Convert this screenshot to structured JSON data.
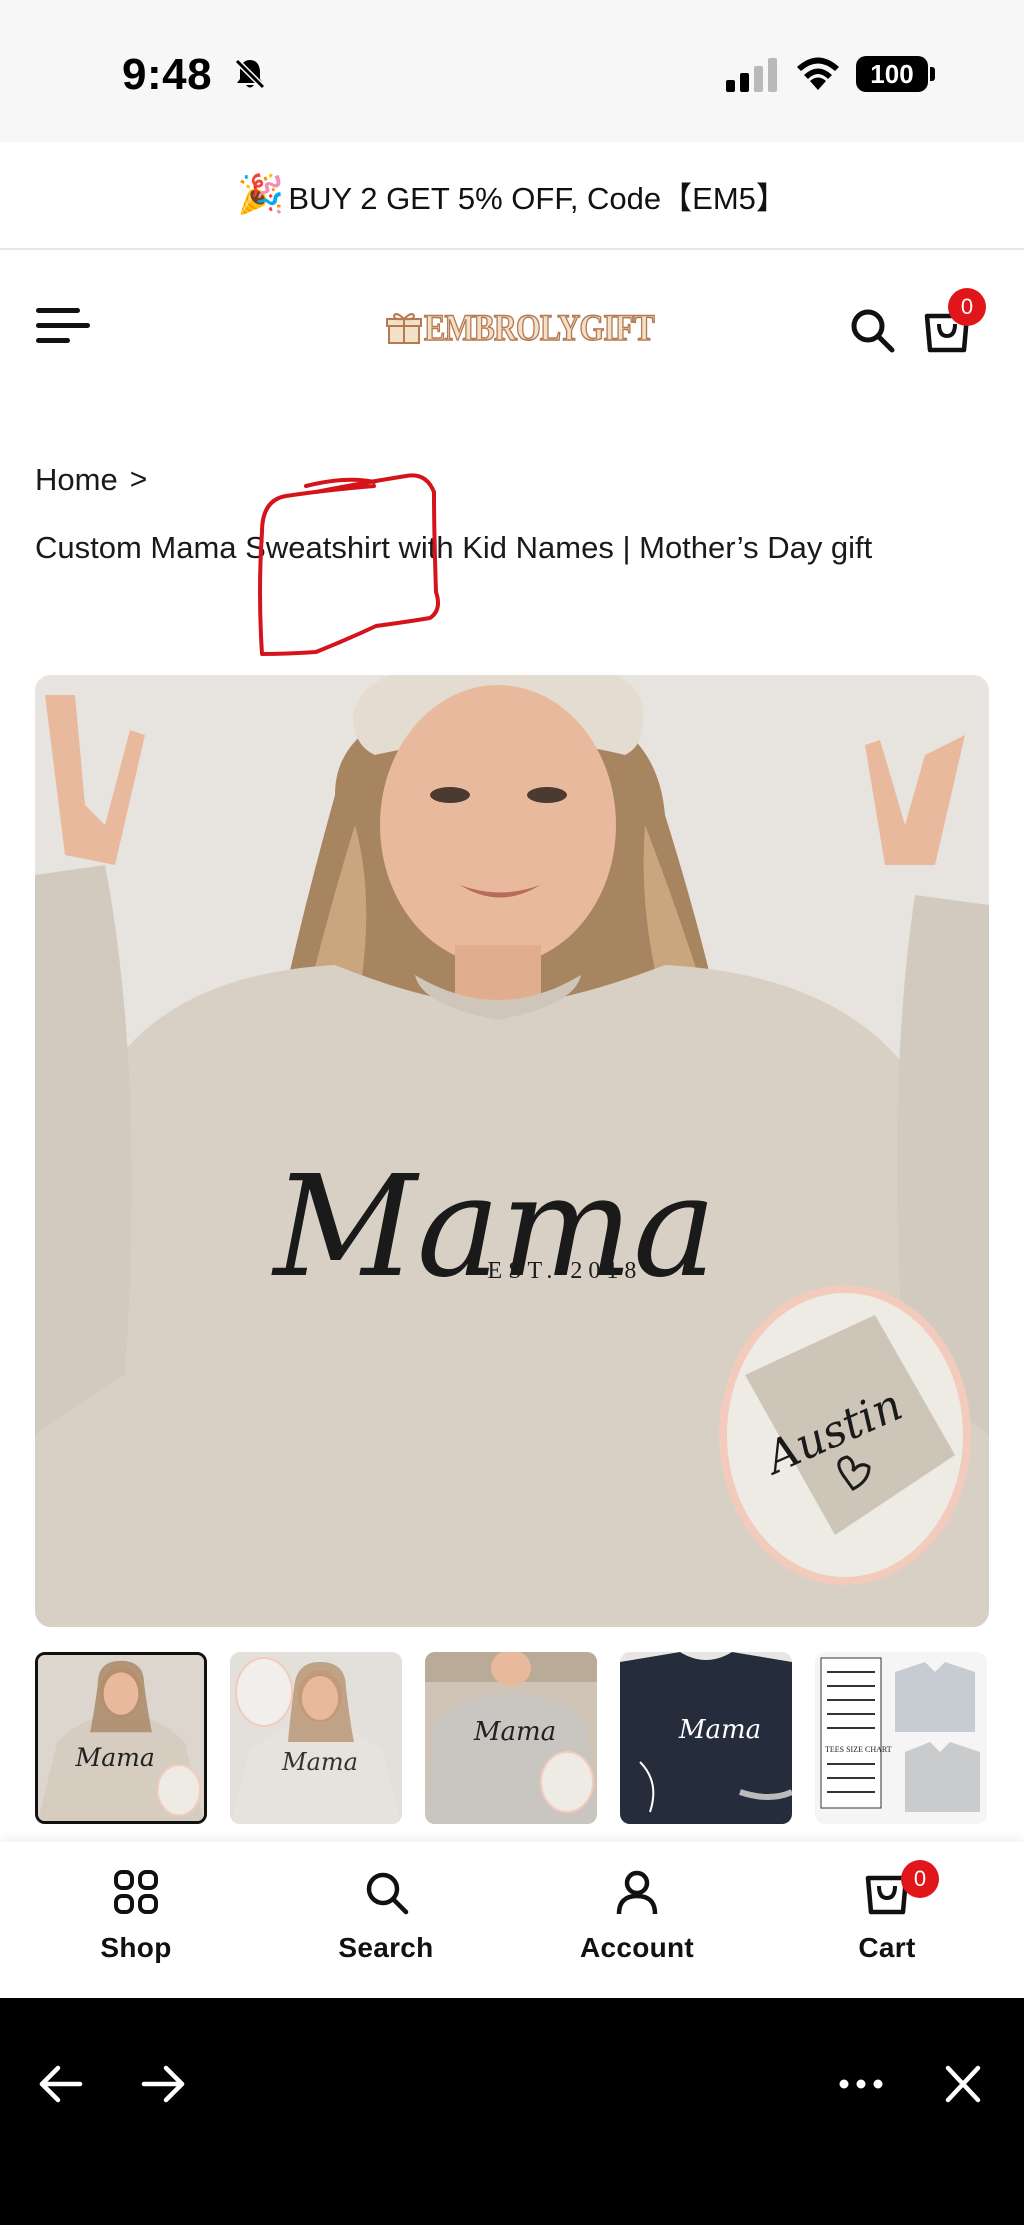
{
  "status_bar": {
    "time": "9:48",
    "battery": "100"
  },
  "promo": {
    "icon": "party-popper-icon",
    "text": "BUY 2 GET 5% OFF, Code【EM5】"
  },
  "header": {
    "logo_text": "EMBROLYGIFT",
    "cart_count": "0"
  },
  "breadcrumb": {
    "home_label": "Home",
    "separator": ">"
  },
  "product": {
    "title": "Custom Mama Sweatshirt with Kid Names | Mother’s Day gift",
    "image_print_main": "Mama",
    "image_print_est": "EST. 2018",
    "image_sleeve_name": "Austin"
  },
  "thumbnails": {
    "count": 5,
    "active_index": 0,
    "size_chart_label": "TEES SIZE CHART"
  },
  "bottom_nav": {
    "shop_label": "Shop",
    "search_label": "Search",
    "account_label": "Account",
    "cart_label": "Cart",
    "cart_count": "0"
  },
  "colors": {
    "badge_red": "#e0161b",
    "annotation_red": "#d4141a",
    "sweatshirt_sand": "#d9d2c7",
    "browser_bar": "#000000"
  }
}
